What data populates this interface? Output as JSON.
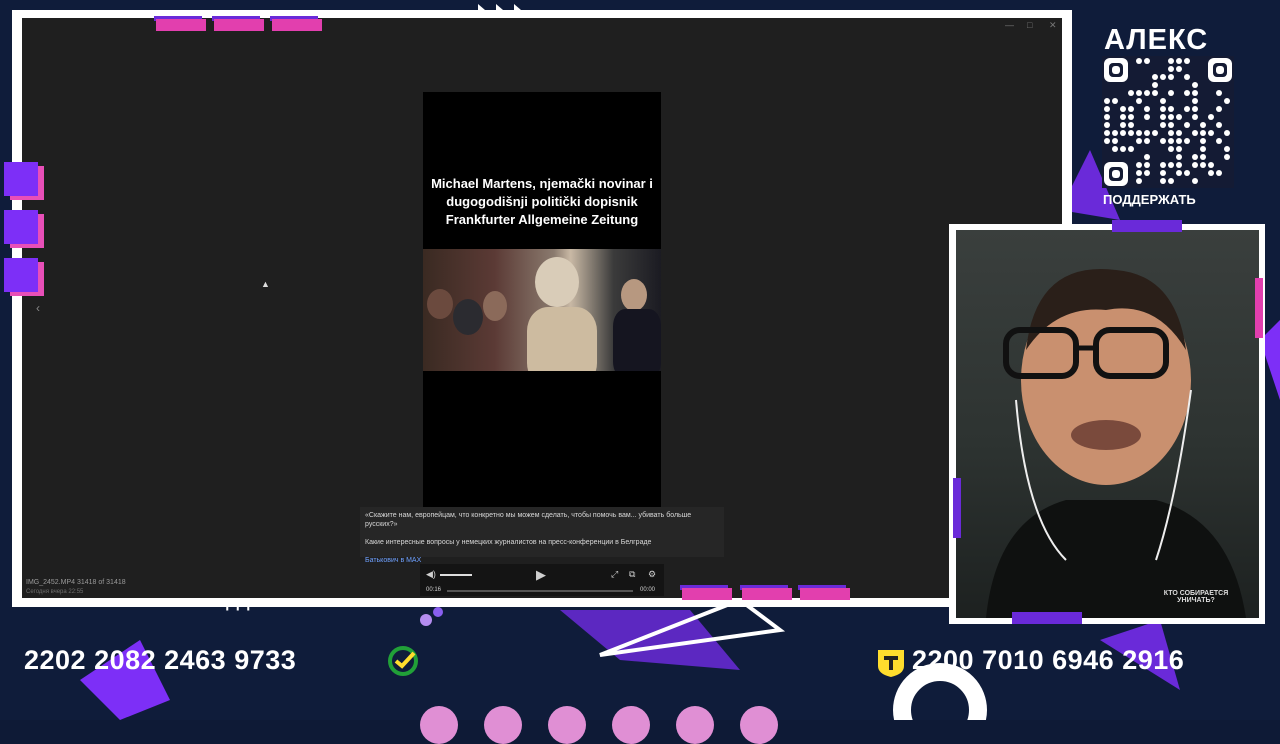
{
  "overlay": {
    "logo_text": "АЛЕКС",
    "support_text": "ПОДДЕРЖАТЬ",
    "card_left": "2202 2082 2463 9733",
    "card_right": "2200 7010 6946 2916",
    "colors": {
      "purple": "#7d2ff7",
      "pink": "#e23fae",
      "background": "#0f1c3a",
      "sber_green": "#21a038",
      "tbank_yellow": "#ffdd2d"
    }
  },
  "viewer": {
    "video_caption": "Michael Martens, njemački novinar i dugogodišnji politički dopisnik Frankfurter Allgemeine Zeitung",
    "post_quote": "«Скажите нам, европейцам, что конкретно мы можем сделать, чтобы помочь вам... убивать больше русских?»",
    "post_body": "Какие интересные вопросы у немецких журналистов на пресс-конференции в Белграде",
    "post_author": "Батькович в MAX",
    "time_current": "00:16",
    "time_total": "00:00",
    "file_info": "IMG_2452.MP4 31418 of 31418",
    "file_info_sub": "Сегодня вчера 22:55",
    "icons": {
      "back": "chevron-left-icon",
      "volume": "volume-icon",
      "play": "play-icon",
      "fullscreen": "fullscreen-icon",
      "pip": "picture-in-picture-icon",
      "settings": "settings-icon"
    }
  },
  "webcam": {
    "shirt_text": "КТО СОБИРАЕТСЯ УНИЧАТЬ?"
  }
}
